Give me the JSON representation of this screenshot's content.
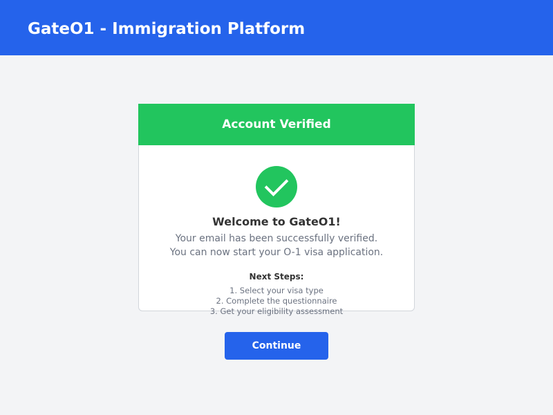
{
  "header": {
    "title": "GateO1 - Immigration Platform",
    "background": "#2563eb"
  },
  "card": {
    "title": "Account Verified",
    "accent": "#22c55e",
    "icon": "checkmark-circle-icon",
    "welcome": "Welcome to GateO1!",
    "message_line1": "Your email has been successfully verified.",
    "message_line2": "You can now start your O-1 visa application.",
    "next_steps_title": "Next Steps:",
    "steps": [
      "1. Select your visa type",
      "2. Complete the questionnaire",
      "3. Get your eligibility assessment"
    ]
  },
  "actions": {
    "continue_label": "Continue",
    "color": "#2563eb"
  }
}
